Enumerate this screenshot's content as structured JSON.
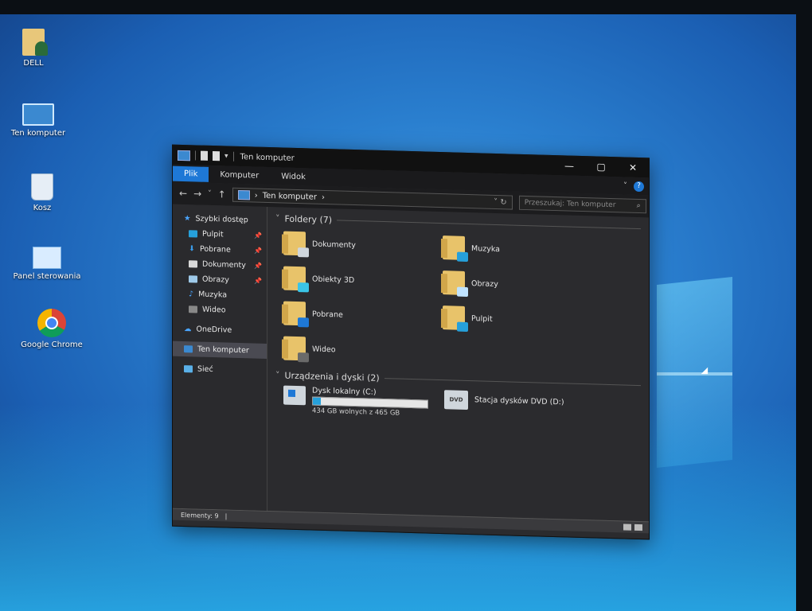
{
  "desktop": {
    "icons": [
      {
        "label": "DELL"
      },
      {
        "label": "Ten komputer"
      },
      {
        "label": "Kosz"
      },
      {
        "label": "Panel sterowania"
      },
      {
        "label": "Google Chrome"
      }
    ]
  },
  "window": {
    "title": "Ten komputer",
    "controls": {
      "minimize": "—",
      "maximize": "▢",
      "close": "✕"
    },
    "ribbon_tabs": [
      "Plik",
      "Komputer",
      "Widok"
    ],
    "help": "?",
    "nav": {
      "back": "←",
      "forward": "→",
      "recent": "˅",
      "up": "↑"
    },
    "address": {
      "path": "Ten komputer",
      "sep": "›"
    },
    "search_placeholder": "Przeszukaj: Ten komputer",
    "sidebar": {
      "items": [
        {
          "label": "Szybki dostęp",
          "icon": "star-icon"
        },
        {
          "label": "Pulpit",
          "icon": "desktop-icon",
          "pinned": true
        },
        {
          "label": "Pobrane",
          "icon": "download-icon",
          "pinned": true
        },
        {
          "label": "Dokumenty",
          "icon": "documents-icon",
          "pinned": true
        },
        {
          "label": "Obrazy",
          "icon": "pictures-icon",
          "pinned": true
        },
        {
          "label": "Muzyka",
          "icon": "music-icon"
        },
        {
          "label": "Wideo",
          "icon": "video-icon"
        },
        {
          "label": "OneDrive",
          "icon": "cloud-icon"
        },
        {
          "label": "Ten komputer",
          "icon": "computer-icon",
          "selected": true
        },
        {
          "label": "Sieć",
          "icon": "network-icon"
        }
      ]
    },
    "folders_header": "Foldery (7)",
    "folders": [
      {
        "label": "Dokumenty",
        "badge_color": "#cfd6dc"
      },
      {
        "label": "Muzyka",
        "badge_color": "#26a0da"
      },
      {
        "label": "Obiekty 3D",
        "badge_color": "#3ac4e6"
      },
      {
        "label": "Obrazy",
        "badge_color": "#bfe3ff"
      },
      {
        "label": "Pobrane",
        "badge_color": "#1e78d6"
      },
      {
        "label": "Pulpit",
        "badge_color": "#26a0da"
      },
      {
        "label": "Wideo",
        "badge_color": "#6a6a6a"
      }
    ],
    "drives_header": "Urządzenia i dyski (2)",
    "drives": [
      {
        "label": "Dysk lokalny (C:)",
        "sub": "434 GB wolnych z 465 GB",
        "used_fraction": 0.067
      },
      {
        "label": "Stacja dysków DVD (D:)",
        "icon_text": "DVD"
      }
    ],
    "status": "Elementy: 9"
  }
}
